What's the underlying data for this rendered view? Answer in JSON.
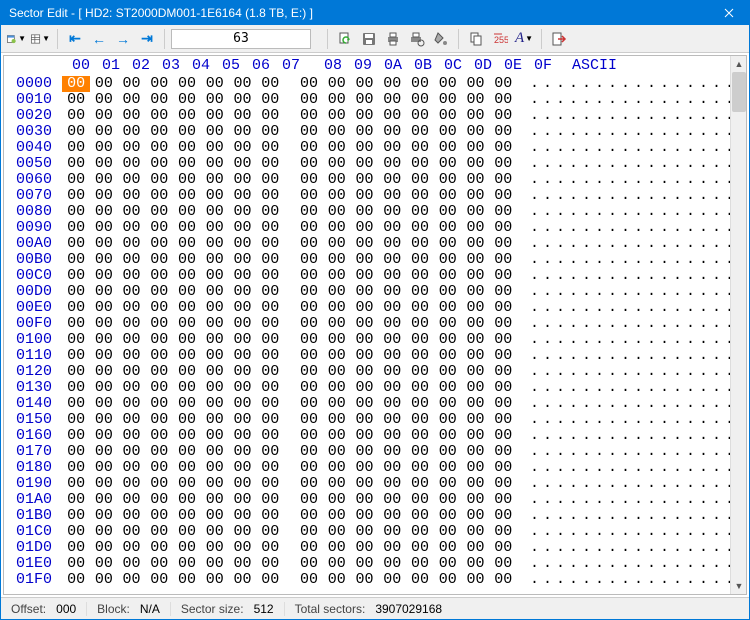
{
  "titlebar": {
    "text": "Sector Edit - [ HD2: ST2000DM001-1E6164 (1.8 TB, E:) ]"
  },
  "toolbar": {
    "sector_value": "63"
  },
  "hex": {
    "columns": [
      "00",
      "01",
      "02",
      "03",
      "04",
      "05",
      "06",
      "07",
      "08",
      "09",
      "0A",
      "0B",
      "0C",
      "0D",
      "0E",
      "0F"
    ],
    "ascii_header": "ASCII",
    "offsets": [
      "0000",
      "0010",
      "0020",
      "0030",
      "0040",
      "0050",
      "0060",
      "0070",
      "0080",
      "0090",
      "00A0",
      "00B0",
      "00C0",
      "00D0",
      "00E0",
      "00F0",
      "0100",
      "0110",
      "0120",
      "0130",
      "0140",
      "0150",
      "0160",
      "0170",
      "0180",
      "0190",
      "01A0",
      "01B0",
      "01C0",
      "01D0",
      "01E0",
      "01F0"
    ],
    "byte": "00",
    "ascii_char": ".",
    "first_ascii_char": "."
  },
  "status": {
    "offset_label": "Offset:",
    "offset_value": "000",
    "block_label": "Block:",
    "block_value": "N/A",
    "sector_size_label": "Sector size:",
    "sector_size_value": "512",
    "total_sectors_label": "Total sectors:",
    "total_sectors_value": "3907029168"
  }
}
